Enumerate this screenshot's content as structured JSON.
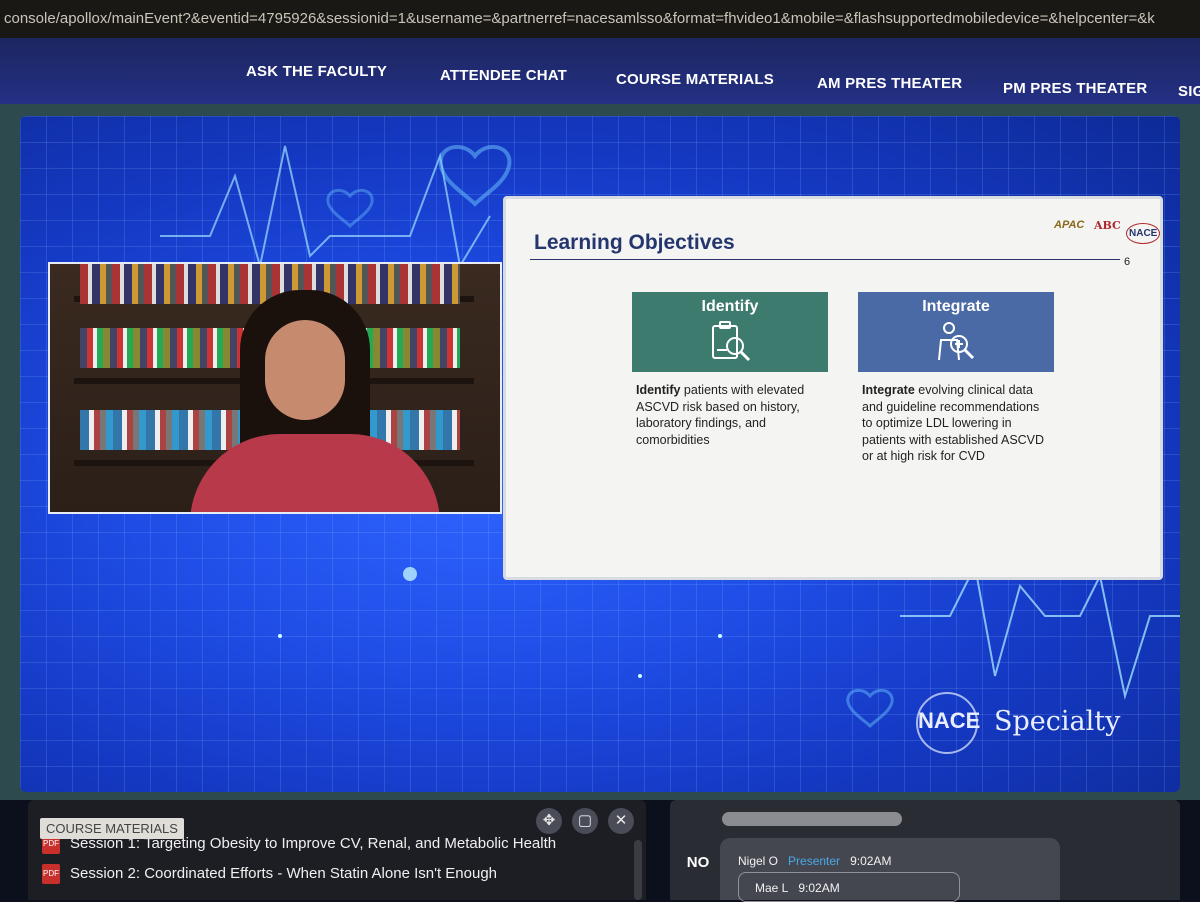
{
  "browser": {
    "url": "console/apollox/mainEvent?&eventid=4795926&sessionid=1&username=&partnerref=nacesamlsso&format=fhvideo1&mobile=&flashsupportedmobiledevice=&helpcenter=&k"
  },
  "nav": {
    "items": [
      {
        "label": "ASK THE FACULTY"
      },
      {
        "label": "ATTENDEE CHAT"
      },
      {
        "label": "COURSE MATERIALS"
      },
      {
        "label": "AM PRES THEATER"
      },
      {
        "label": "PM PRES THEATER"
      },
      {
        "label": "SIG"
      }
    ]
  },
  "slide": {
    "title": "Learning Objectives",
    "page_number": "6",
    "logos": [
      "APAC",
      "ABC",
      "NACE"
    ],
    "cards": [
      {
        "heading": "Identify",
        "icon": "clipboard-magnifier-icon",
        "bold": "Identify",
        "text": " patients with elevated ASCVD risk based on history, laboratory findings, and comorbidities",
        "color": "#3e7b6f"
      },
      {
        "heading": "Integrate",
        "icon": "person-magnifier-icon",
        "bold": "Integrate",
        "text": " evolving clinical data and guideline recommendations to optimize LDL lowering in patients with established ASCVD or at high risk for CVD",
        "color": "#4a6aa6"
      }
    ]
  },
  "brand": {
    "name": "NACE",
    "suffix": "Specialty"
  },
  "materials": {
    "tag": "COURSE MATERIALS",
    "sessions": [
      "Session 1: Targeting Obesity to Improve CV, Renal, and Metabolic Health",
      "Session 2: Coordinated Efforts - When Statin Alone Isn't Enough"
    ]
  },
  "chat": {
    "badge": "NO",
    "messages": [
      {
        "user": "Nigel O",
        "role": "Presenter",
        "time": "9:02AM"
      },
      {
        "user": "Mae L",
        "time": "9:02AM"
      }
    ]
  },
  "colors": {
    "nav_bg": "#243084",
    "stage_blue": "#1f4de6",
    "slide_title": "#25366f"
  }
}
